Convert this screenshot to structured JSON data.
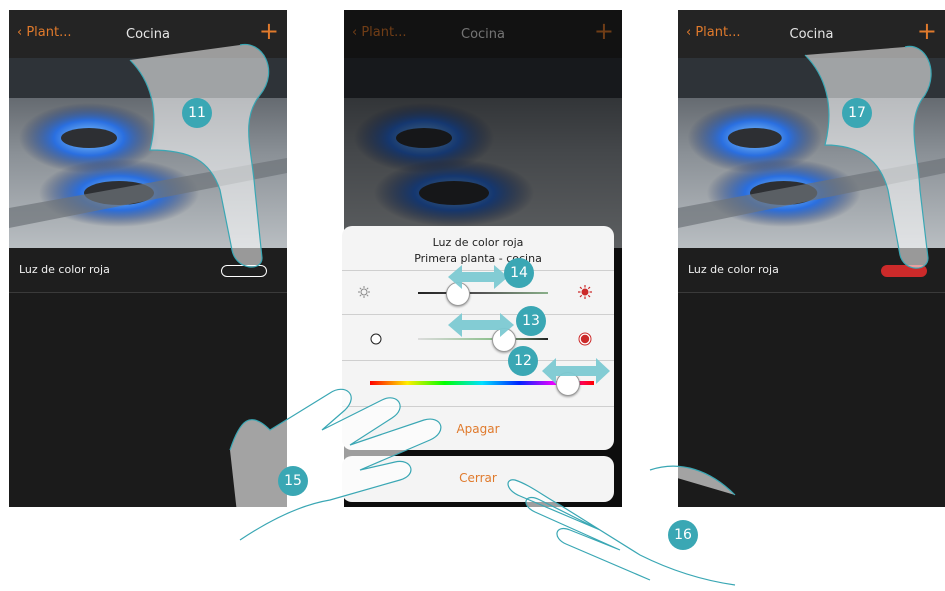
{
  "phones": {
    "left": {
      "back": "Plant...",
      "title": "Cocina",
      "plus": "+",
      "row_label": "Luz de color roja"
    },
    "middle": {
      "back": "Plant...",
      "title": "Cocina",
      "plus": "+"
    },
    "right": {
      "back": "Plant...",
      "title": "Cocina",
      "plus": "+",
      "row_label": "Luz de color roja"
    }
  },
  "popup": {
    "title_line1": "Luz de color roja",
    "title_line2": "Primera planta - cocina",
    "brightness_level": 0.3,
    "saturation_level": 0.65,
    "hue_level": 0.88,
    "off_label": "Apagar",
    "close_label": "Cerrar"
  },
  "steps": {
    "s11": "11",
    "s12": "12",
    "s13": "13",
    "s14": "14",
    "s15": "15",
    "s16": "16",
    "s17": "17"
  },
  "colors": {
    "accent": "#e07a2c",
    "badge": "#3aa7b4",
    "red_on": "#cc2a2a"
  }
}
